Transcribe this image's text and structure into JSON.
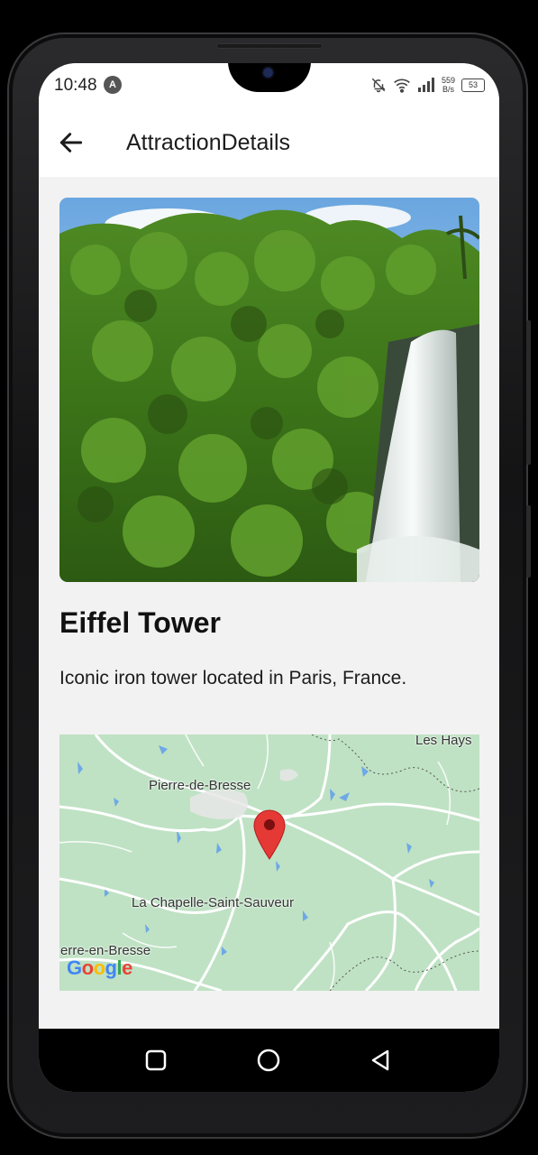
{
  "status_bar": {
    "time": "10:48",
    "app_badge": "A",
    "net_speed_value": "559",
    "net_speed_unit": "B/s",
    "battery": "53"
  },
  "app_bar": {
    "title": "AttractionDetails"
  },
  "attraction": {
    "name": "Eiffel Tower",
    "description": "Iconic iron tower located in Paris, France."
  },
  "map": {
    "labels": {
      "les_hays": "Les Hays",
      "pierre_de_bresse": "Pierre-de-Bresse",
      "la_chapelle": "La Chapelle-Saint-Sauveur",
      "erre_en_bresse": "erre-en-Bresse"
    },
    "attribution": "Google",
    "marker_color": "#e53935"
  },
  "icons": {
    "back": "arrow-left-icon",
    "recents": "square-icon",
    "home": "circle-icon",
    "back_nav": "triangle-left-icon"
  }
}
